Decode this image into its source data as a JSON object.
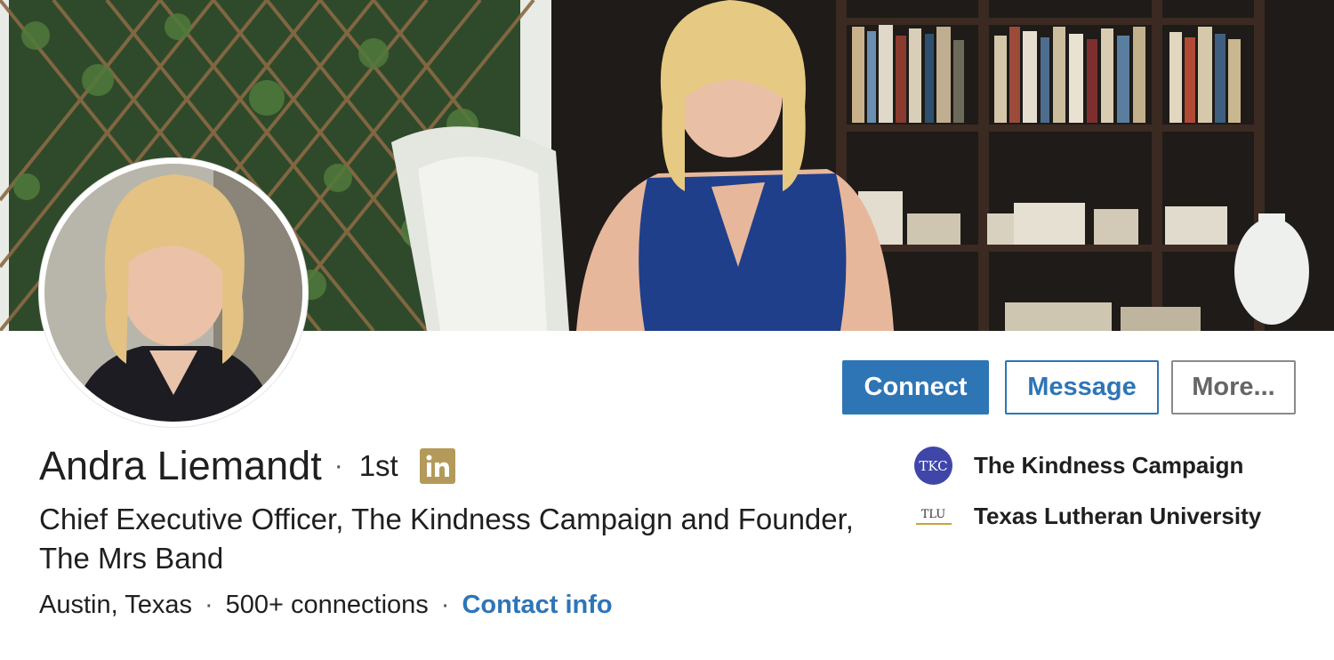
{
  "profile": {
    "name": "Andra Liemandt",
    "separator": "·",
    "connection_degree": "1st",
    "headline": "Chief Executive Officer, The Kindness Campaign and Founder, The Mrs Band",
    "location": "Austin, Texas",
    "connections": "500+ connections",
    "contact_label": "Contact info",
    "premium_badge_letters": "in",
    "badge_color": "#b39a5a"
  },
  "actions": {
    "connect": "Connect",
    "message": "Message",
    "more": "More..."
  },
  "orgs": [
    {
      "name": "The Kindness Campaign",
      "logo_text": "TKC",
      "logo_color": "#3f46a8"
    },
    {
      "name": "Texas Lutheran University",
      "logo_text": "TLU"
    }
  ],
  "colors": {
    "accent": "#2e75b6",
    "text": "#1f1f1f",
    "muted_border": "#8a8a8a"
  }
}
